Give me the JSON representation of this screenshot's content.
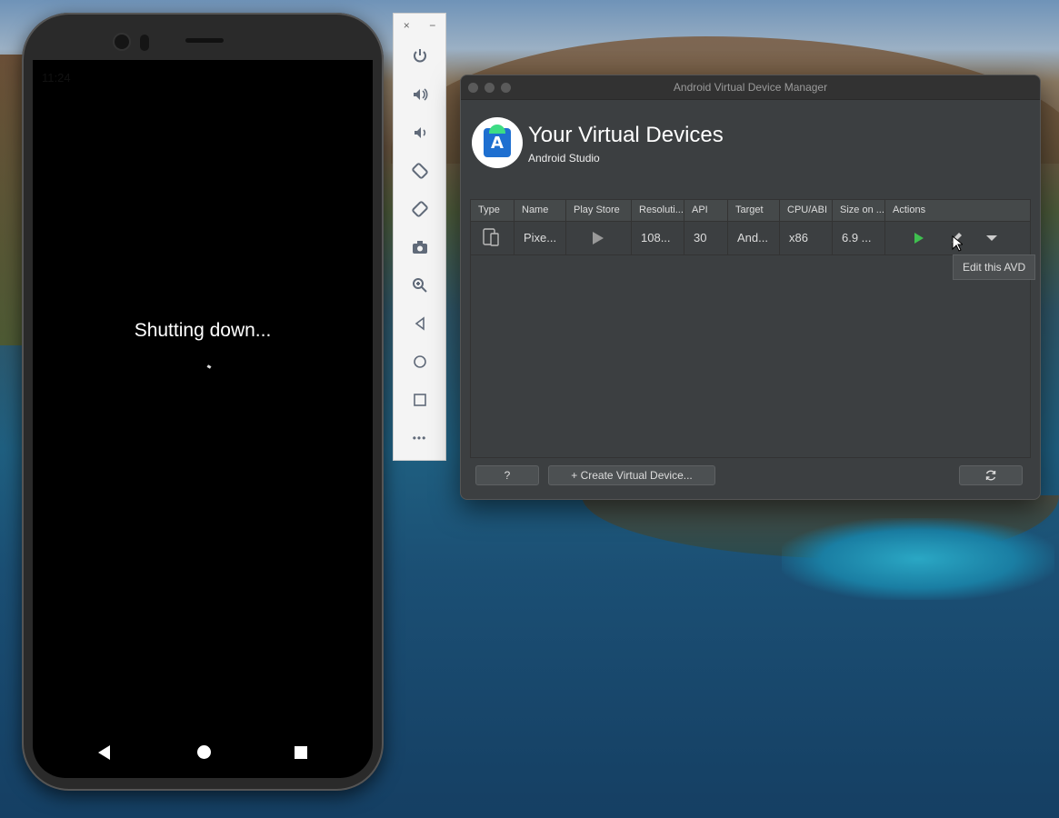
{
  "emulator": {
    "status_time": "11:24",
    "screen_message": "Shutting down...",
    "toolbar": {
      "close": "×",
      "minimize": "−",
      "more": "•••"
    }
  },
  "avd_manager": {
    "window_title": "Android Virtual Device Manager",
    "header_title": "Your Virtual Devices",
    "header_subtitle": "Android Studio",
    "columns": [
      "Type",
      "Name",
      "Play Store",
      "Resoluti...",
      "API",
      "Target",
      "CPU/ABI",
      "Size on ...",
      "Actions"
    ],
    "rows": [
      {
        "name": "Pixe...",
        "resolution": "108...",
        "api": "30",
        "target": "And...",
        "cpu": "x86",
        "size": "6.9 ..."
      }
    ],
    "tooltip": "Edit this AVD",
    "help_label": "?",
    "create_label": "+ Create Virtual Device...",
    "colors": {
      "run": "#3fbf4f",
      "window_bg": "#3c3f41"
    }
  }
}
